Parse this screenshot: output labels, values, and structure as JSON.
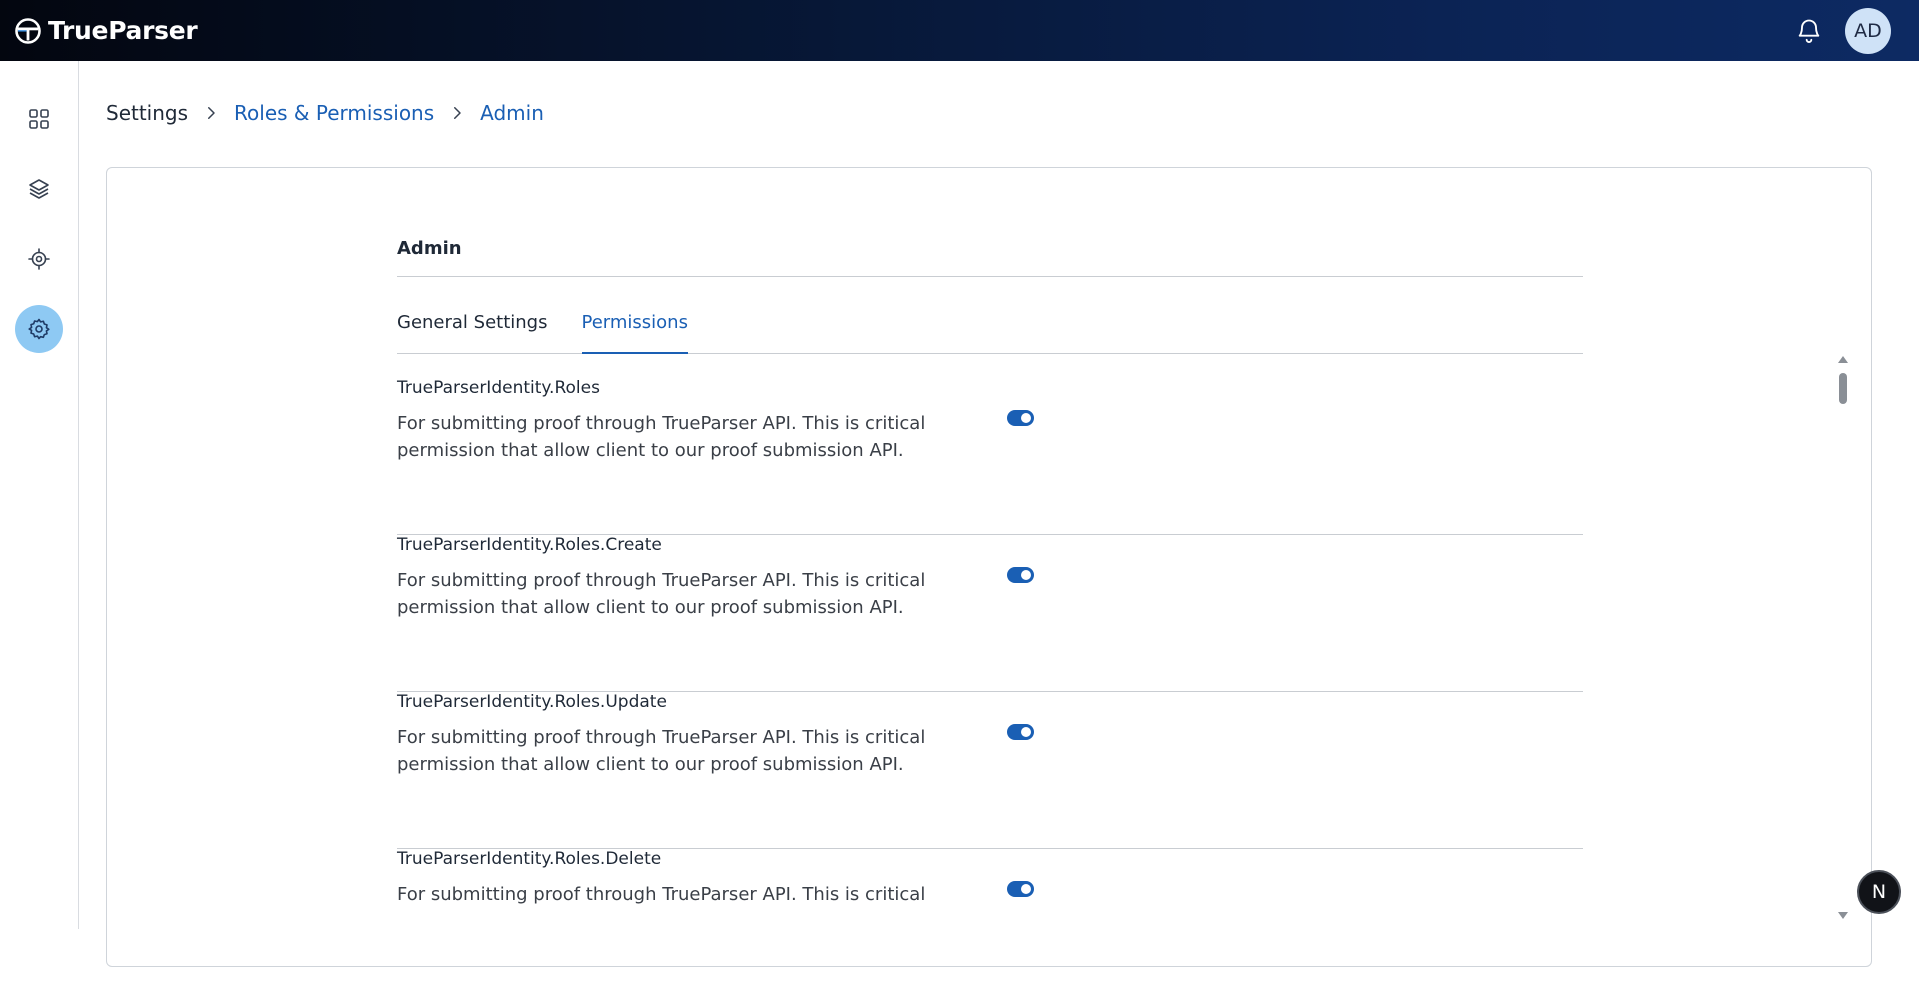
{
  "brand": {
    "name": "TrueParser"
  },
  "header": {
    "avatar_initials": "AD"
  },
  "breadcrumb": {
    "root": "Settings",
    "mid": "Roles & Permissions",
    "current": "Admin"
  },
  "role": {
    "title": "Admin"
  },
  "tabs": [
    {
      "label": "General Settings",
      "active": false
    },
    {
      "label": "Permissions",
      "active": true
    }
  ],
  "permissions": [
    {
      "name": "TrueParserIdentity.Roles",
      "description": "For submitting proof through TrueParser API. This is critical permission that allow client to our proof submission API.",
      "enabled": true
    },
    {
      "name": "TrueParserIdentity.Roles.Create",
      "description": "For submitting proof through TrueParser API. This is critical permission that allow client to our proof submission API.",
      "enabled": true
    },
    {
      "name": "TrueParserIdentity.Roles.Update",
      "description": "For submitting proof through TrueParser API. This is critical permission that allow client to our proof submission API.",
      "enabled": true
    },
    {
      "name": "TrueParserIdentity.Roles.Delete",
      "description": "For submitting proof through TrueParser API. This is critical",
      "enabled": true
    }
  ],
  "fab": {
    "label": "N"
  },
  "icons": {
    "rail": [
      "grid-icon",
      "layers-icon",
      "target-icon",
      "gear-icon"
    ],
    "header": [
      "bell-icon"
    ]
  },
  "colors": {
    "accent": "#1a5fb4",
    "rail_active": "#8ec9f3",
    "topbar_dark": "#03060f",
    "topbar_light": "#0d2a63"
  }
}
